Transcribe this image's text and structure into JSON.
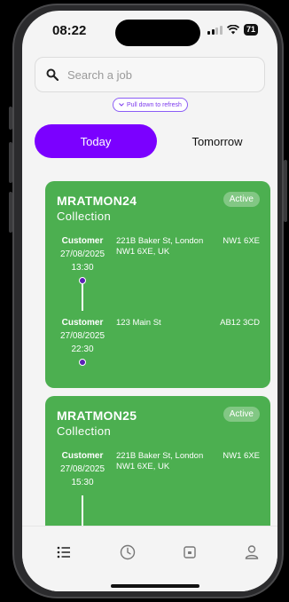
{
  "status_bar": {
    "time": "08:22",
    "battery": "71"
  },
  "search": {
    "placeholder": "Search a job"
  },
  "refresh_hint": "Pull down to refresh",
  "tabs": {
    "today": "Today",
    "tomorrow": "Tomorrow",
    "active": "Today"
  },
  "jobs": [
    {
      "ref": "MRATMON24",
      "type": "Collection",
      "status": "Active",
      "stops": [
        {
          "role": "Customer",
          "date": "27/08/2025",
          "time": "13:30",
          "address": "221B Baker St, London NW1 6XE, UK",
          "postcode": "NW1 6XE"
        },
        {
          "role": "Customer",
          "date": "27/08/2025",
          "time": "22:30",
          "address": "123 Main St",
          "postcode": "AB12 3CD"
        }
      ]
    },
    {
      "ref": "MRATMON25",
      "type": "Collection",
      "status": "Active",
      "stops": [
        {
          "role": "Customer",
          "date": "27/08/2025",
          "time": "15:30",
          "address": "221B Baker St, London NW1 6XE, UK",
          "postcode": "NW1 6XE"
        }
      ]
    }
  ],
  "colors": {
    "accent": "#7b00ff",
    "card": "#4caf50",
    "dot": "#5b21b6"
  },
  "bottom_nav": [
    "list-icon",
    "clock-icon",
    "wallet-icon",
    "user-icon"
  ]
}
